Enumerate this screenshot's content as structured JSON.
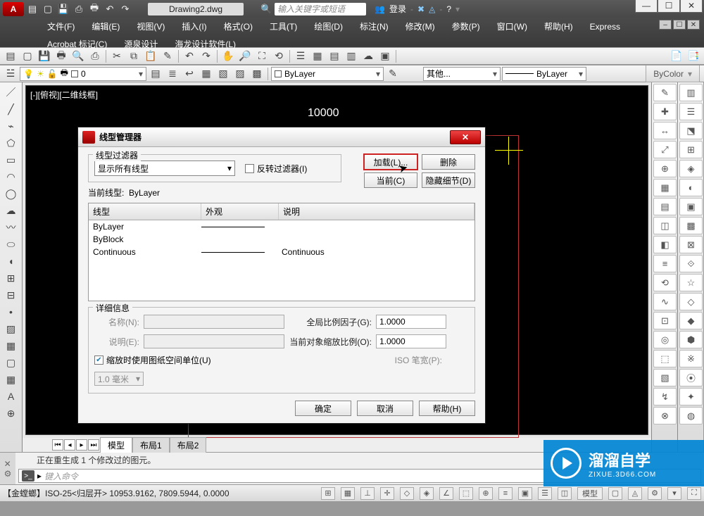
{
  "titlebar": {
    "logo": "A",
    "doc": "Drawing2.dwg",
    "searchPlaceholder": "输入关键字或短语",
    "login": "登录"
  },
  "menu": {
    "row1": [
      "文件(F)",
      "编辑(E)",
      "视图(V)",
      "插入(I)",
      "格式(O)",
      "工具(T)",
      "绘图(D)",
      "标注(N)",
      "修改(M)",
      "参数(P)",
      "窗口(W)",
      "帮助(H)",
      "Express"
    ],
    "row2": [
      "Acrobat 标记(C)",
      "源泉设计",
      "海龙设计软件(L)"
    ]
  },
  "toolbar2": {
    "layerCombo": "0",
    "linetypeCombo": "ByLayer",
    "colorCombo": "其他...",
    "lw2": "ByLayer",
    "propLabel": "ByColor"
  },
  "viewport": {
    "label": "[-][俯视][二维线框]",
    "dim": "10000"
  },
  "tabs": {
    "items": [
      "模型",
      "布局1",
      "布局2"
    ],
    "active": 0
  },
  "cmd": {
    "line1": "正在重生成 1 个修改过的图元。",
    "placeholder": "键入命令"
  },
  "status": {
    "info": "【金螳螂】ISO-25<归层开>  10953.9162, 7809.5944, 0.0000",
    "modelBtn": "模型"
  },
  "dialog": {
    "title": "线型管理器",
    "filterLegend": "线型过滤器",
    "filterCombo": "显示所有线型",
    "invert": "反转过滤器(I)",
    "btnLoad": "加载(L)...",
    "btnDelete": "删除",
    "btnCurrent": "当前(C)",
    "btnHide": "隐藏细节(D)",
    "currentLabel": "当前线型:",
    "currentValue": "ByLayer",
    "cols": [
      "线型",
      "外观",
      "说明"
    ],
    "rows": [
      {
        "name": "ByLayer",
        "preview": true,
        "desc": ""
      },
      {
        "name": "ByBlock",
        "preview": false,
        "desc": ""
      },
      {
        "name": "Continuous",
        "preview": true,
        "desc": "Continuous"
      }
    ],
    "detailsLegend": "详细信息",
    "det": {
      "nameLbl": "名称(N):",
      "descLbl": "说明(E):",
      "globalLbl": "全局比例因子(G):",
      "globalVal": "1.0000",
      "objLbl": "当前对象缩放比例(O):",
      "objVal": "1.0000",
      "isoLbl": "ISO 笔宽(P):",
      "isoVal": "1.0 毫米",
      "paperChk": "缩放时使用图纸空间单位(U)"
    },
    "ok": "确定",
    "cancel": "取消",
    "help": "帮助(H)"
  },
  "watermark": {
    "t1": "溜溜自学",
    "t2": "ZIXUE.3D66.COM"
  }
}
